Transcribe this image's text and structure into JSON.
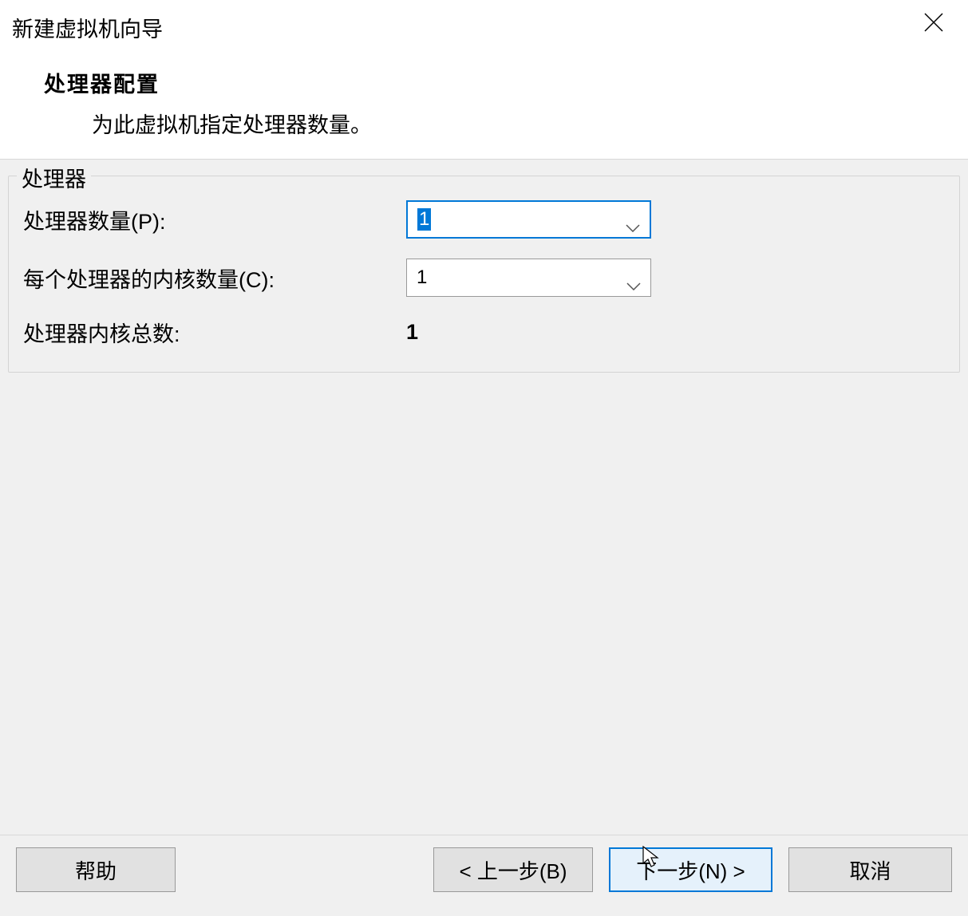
{
  "window": {
    "title": "新建虚拟机向导"
  },
  "header": {
    "section_title": "处理器配置",
    "section_desc": "为此虚拟机指定处理器数量。"
  },
  "fieldset": {
    "legend": "处理器",
    "rows": {
      "processor_count": {
        "label": "处理器数量(P):",
        "value": "1"
      },
      "cores_per_processor": {
        "label": "每个处理器的内核数量(C):",
        "value": "1"
      },
      "total_cores": {
        "label": "处理器内核总数:",
        "value": "1"
      }
    }
  },
  "footer": {
    "help": "帮助",
    "back": "< 上一步(B)",
    "next": "下一步(N) >",
    "cancel": "取消"
  }
}
